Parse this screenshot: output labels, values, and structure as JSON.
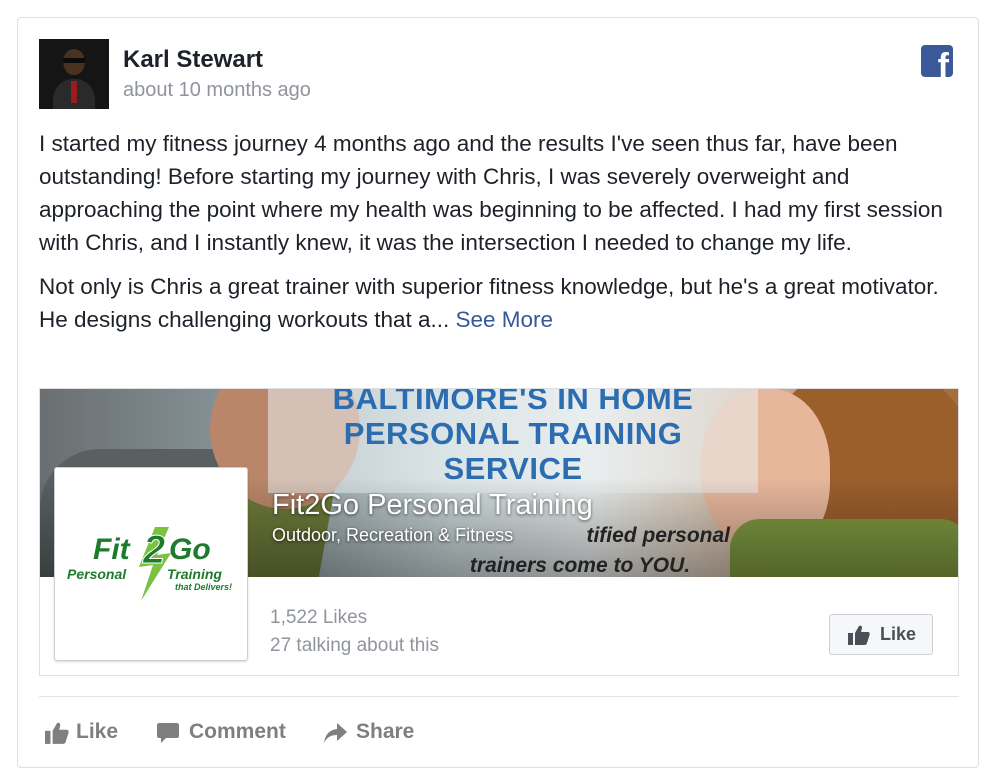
{
  "post": {
    "author": "Karl Stewart",
    "timestamp": "about 10 months ago",
    "paragraph1": "I started my fitness journey 4 months ago and the results I've seen thus far, have been outstanding! Before starting my journey with Chris, I was severely overweight and approaching the point where my health was beginning to be affected. I had my first session with Chris, and I instantly knew, it was the intersection I needed to change my life.",
    "paragraph2": "Not only is Chris a great trainer with superior fitness knowledge, but he's a great motivator. He designs challenging workouts that a...",
    "see_more": "See More"
  },
  "page_plugin": {
    "cover_headline_line1": "BALTIMORE'S IN HOME",
    "cover_headline_line2": "PERSONAL TRAINING",
    "cover_headline_line3": "SERVICE",
    "cover_tagline_line1": "tified personal",
    "cover_tagline_line2": "trainers come to YOU.",
    "page_name": "Fit2Go Personal Training",
    "category": "Outdoor, Recreation & Fitness",
    "logo_word1": "Fit",
    "logo_num": "2",
    "logo_word2": "Go",
    "logo_sub1": "Personal",
    "logo_sub2": "Training",
    "logo_sub3": "that Delivers!",
    "likes": "1,522 Likes",
    "talking": "27 talking about this",
    "like_button": "Like"
  },
  "actions": {
    "like": "Like",
    "comment": "Comment",
    "share": "Share"
  },
  "colors": {
    "facebook_blue": "#3b5998",
    "link_blue": "#365899",
    "secondary_text": "#90949c",
    "logo_green": "#1e7b2c"
  },
  "icons": [
    "facebook-icon",
    "thumbs-up-icon",
    "comment-icon",
    "share-icon"
  ]
}
